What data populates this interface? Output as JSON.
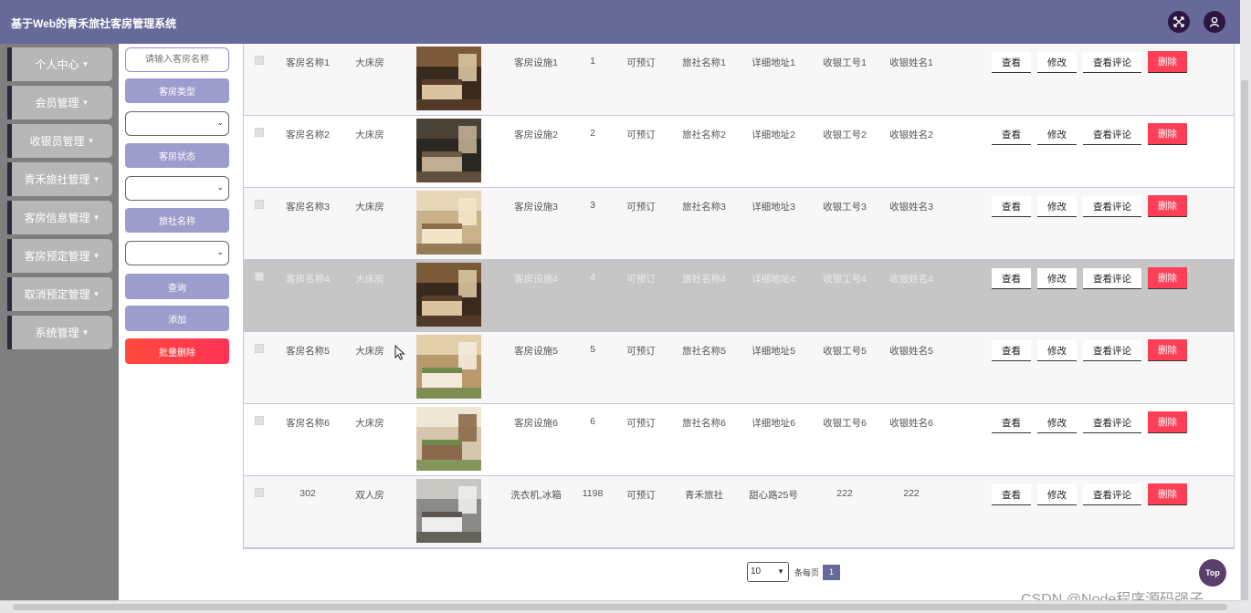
{
  "app": {
    "title": "基于Web的青禾旅社客房管理系统"
  },
  "header_icons": [
    "fullscreen-icon",
    "user-icon"
  ],
  "sidebar": {
    "items": [
      {
        "label": "个人中心"
      },
      {
        "label": "会员管理"
      },
      {
        "label": "收银员管理"
      },
      {
        "label": "青禾旅社管理"
      },
      {
        "label": "客房信息管理"
      },
      {
        "label": "客房预定管理"
      },
      {
        "label": "取消预定管理"
      },
      {
        "label": "系统管理"
      }
    ]
  },
  "filter": {
    "name_placeholder": "请输入客房名称",
    "type_label": "客房类型",
    "type_value": "",
    "status_label": "客房状态",
    "status_value": "",
    "hotel_label": "旅社名称",
    "hotel_value": "",
    "query_button": "查询",
    "add_button": "添加",
    "batch_delete_button": "批量删除"
  },
  "table": {
    "actions": {
      "view": "查看",
      "edit": "修改",
      "review": "查看评论",
      "delete": "删除"
    },
    "rows": [
      {
        "name": "客房名称1",
        "type": "大床房",
        "image": "room-photo-1",
        "facility": "客房设施1",
        "price": "1",
        "status": "可预订",
        "hotel": "旅社名称1",
        "address": "详细地址1",
        "cashier_no": "收银工号1",
        "cashier_name": "收银姓名1"
      },
      {
        "name": "客房名称2",
        "type": "大床房",
        "image": "room-photo-2",
        "facility": "客房设施2",
        "price": "2",
        "status": "可预订",
        "hotel": "旅社名称2",
        "address": "详细地址2",
        "cashier_no": "收银工号2",
        "cashier_name": "收银姓名2"
      },
      {
        "name": "客房名称3",
        "type": "大床房",
        "image": "room-photo-3",
        "facility": "客房设施3",
        "price": "3",
        "status": "可预订",
        "hotel": "旅社名称3",
        "address": "详细地址3",
        "cashier_no": "收银工号3",
        "cashier_name": "收银姓名3"
      },
      {
        "name": "客房名称4",
        "type": "大床房",
        "image": "room-photo-4",
        "facility": "客房设施4",
        "price": "4",
        "status": "可预订",
        "hotel": "旅社名称4",
        "address": "详细地址4",
        "cashier_no": "收银工号4",
        "cashier_name": "收银姓名4"
      },
      {
        "name": "客房名称5",
        "type": "大床房",
        "image": "room-photo-5",
        "facility": "客房设施5",
        "price": "5",
        "status": "可预订",
        "hotel": "旅社名称5",
        "address": "详细地址5",
        "cashier_no": "收银工号5",
        "cashier_name": "收银姓名5"
      },
      {
        "name": "客房名称6",
        "type": "大床房",
        "image": "room-photo-6",
        "facility": "客房设施6",
        "price": "6",
        "status": "可预订",
        "hotel": "旅社名称6",
        "address": "详细地址6",
        "cashier_no": "收银工号6",
        "cashier_name": "收银姓名6"
      },
      {
        "name": "302",
        "type": "双人房",
        "image": "room-photo-7",
        "facility": "洗衣机,冰箱",
        "price": "1198",
        "status": "可预订",
        "hotel": "青禾旅社",
        "address": "甜心路25号",
        "cashier_no": "222",
        "cashier_name": "222"
      }
    ]
  },
  "pagination": {
    "page_size": "10",
    "per_page_label": "条每页",
    "current_page": "1"
  },
  "top_button": "Top",
  "watermark": "CSDN @Node程序源码强子",
  "colors": {
    "header": "#676a99",
    "accent": "#9c9ccd",
    "danger": "#ff3f55",
    "sidebar": "#7f7f7f"
  }
}
